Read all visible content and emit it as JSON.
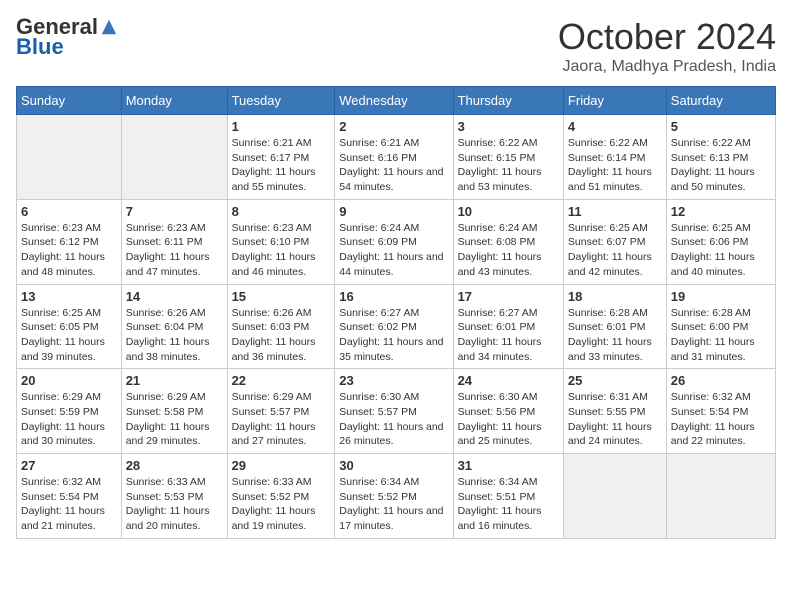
{
  "header": {
    "logo_general": "General",
    "logo_blue": "Blue",
    "month_title": "October 2024",
    "location": "Jaora, Madhya Pradesh, India"
  },
  "calendar": {
    "days_of_week": [
      "Sunday",
      "Monday",
      "Tuesday",
      "Wednesday",
      "Thursday",
      "Friday",
      "Saturday"
    ],
    "weeks": [
      [
        {
          "day": "",
          "info": ""
        },
        {
          "day": "",
          "info": ""
        },
        {
          "day": "1",
          "info": "Sunrise: 6:21 AM\nSunset: 6:17 PM\nDaylight: 11 hours and 55 minutes."
        },
        {
          "day": "2",
          "info": "Sunrise: 6:21 AM\nSunset: 6:16 PM\nDaylight: 11 hours and 54 minutes."
        },
        {
          "day": "3",
          "info": "Sunrise: 6:22 AM\nSunset: 6:15 PM\nDaylight: 11 hours and 53 minutes."
        },
        {
          "day": "4",
          "info": "Sunrise: 6:22 AM\nSunset: 6:14 PM\nDaylight: 11 hours and 51 minutes."
        },
        {
          "day": "5",
          "info": "Sunrise: 6:22 AM\nSunset: 6:13 PM\nDaylight: 11 hours and 50 minutes."
        }
      ],
      [
        {
          "day": "6",
          "info": "Sunrise: 6:23 AM\nSunset: 6:12 PM\nDaylight: 11 hours and 48 minutes."
        },
        {
          "day": "7",
          "info": "Sunrise: 6:23 AM\nSunset: 6:11 PM\nDaylight: 11 hours and 47 minutes."
        },
        {
          "day": "8",
          "info": "Sunrise: 6:23 AM\nSunset: 6:10 PM\nDaylight: 11 hours and 46 minutes."
        },
        {
          "day": "9",
          "info": "Sunrise: 6:24 AM\nSunset: 6:09 PM\nDaylight: 11 hours and 44 minutes."
        },
        {
          "day": "10",
          "info": "Sunrise: 6:24 AM\nSunset: 6:08 PM\nDaylight: 11 hours and 43 minutes."
        },
        {
          "day": "11",
          "info": "Sunrise: 6:25 AM\nSunset: 6:07 PM\nDaylight: 11 hours and 42 minutes."
        },
        {
          "day": "12",
          "info": "Sunrise: 6:25 AM\nSunset: 6:06 PM\nDaylight: 11 hours and 40 minutes."
        }
      ],
      [
        {
          "day": "13",
          "info": "Sunrise: 6:25 AM\nSunset: 6:05 PM\nDaylight: 11 hours and 39 minutes."
        },
        {
          "day": "14",
          "info": "Sunrise: 6:26 AM\nSunset: 6:04 PM\nDaylight: 11 hours and 38 minutes."
        },
        {
          "day": "15",
          "info": "Sunrise: 6:26 AM\nSunset: 6:03 PM\nDaylight: 11 hours and 36 minutes."
        },
        {
          "day": "16",
          "info": "Sunrise: 6:27 AM\nSunset: 6:02 PM\nDaylight: 11 hours and 35 minutes."
        },
        {
          "day": "17",
          "info": "Sunrise: 6:27 AM\nSunset: 6:01 PM\nDaylight: 11 hours and 34 minutes."
        },
        {
          "day": "18",
          "info": "Sunrise: 6:28 AM\nSunset: 6:01 PM\nDaylight: 11 hours and 33 minutes."
        },
        {
          "day": "19",
          "info": "Sunrise: 6:28 AM\nSunset: 6:00 PM\nDaylight: 11 hours and 31 minutes."
        }
      ],
      [
        {
          "day": "20",
          "info": "Sunrise: 6:29 AM\nSunset: 5:59 PM\nDaylight: 11 hours and 30 minutes."
        },
        {
          "day": "21",
          "info": "Sunrise: 6:29 AM\nSunset: 5:58 PM\nDaylight: 11 hours and 29 minutes."
        },
        {
          "day": "22",
          "info": "Sunrise: 6:29 AM\nSunset: 5:57 PM\nDaylight: 11 hours and 27 minutes."
        },
        {
          "day": "23",
          "info": "Sunrise: 6:30 AM\nSunset: 5:57 PM\nDaylight: 11 hours and 26 minutes."
        },
        {
          "day": "24",
          "info": "Sunrise: 6:30 AM\nSunset: 5:56 PM\nDaylight: 11 hours and 25 minutes."
        },
        {
          "day": "25",
          "info": "Sunrise: 6:31 AM\nSunset: 5:55 PM\nDaylight: 11 hours and 24 minutes."
        },
        {
          "day": "26",
          "info": "Sunrise: 6:32 AM\nSunset: 5:54 PM\nDaylight: 11 hours and 22 minutes."
        }
      ],
      [
        {
          "day": "27",
          "info": "Sunrise: 6:32 AM\nSunset: 5:54 PM\nDaylight: 11 hours and 21 minutes."
        },
        {
          "day": "28",
          "info": "Sunrise: 6:33 AM\nSunset: 5:53 PM\nDaylight: 11 hours and 20 minutes."
        },
        {
          "day": "29",
          "info": "Sunrise: 6:33 AM\nSunset: 5:52 PM\nDaylight: 11 hours and 19 minutes."
        },
        {
          "day": "30",
          "info": "Sunrise: 6:34 AM\nSunset: 5:52 PM\nDaylight: 11 hours and 17 minutes."
        },
        {
          "day": "31",
          "info": "Sunrise: 6:34 AM\nSunset: 5:51 PM\nDaylight: 11 hours and 16 minutes."
        },
        {
          "day": "",
          "info": ""
        },
        {
          "day": "",
          "info": ""
        }
      ]
    ]
  }
}
